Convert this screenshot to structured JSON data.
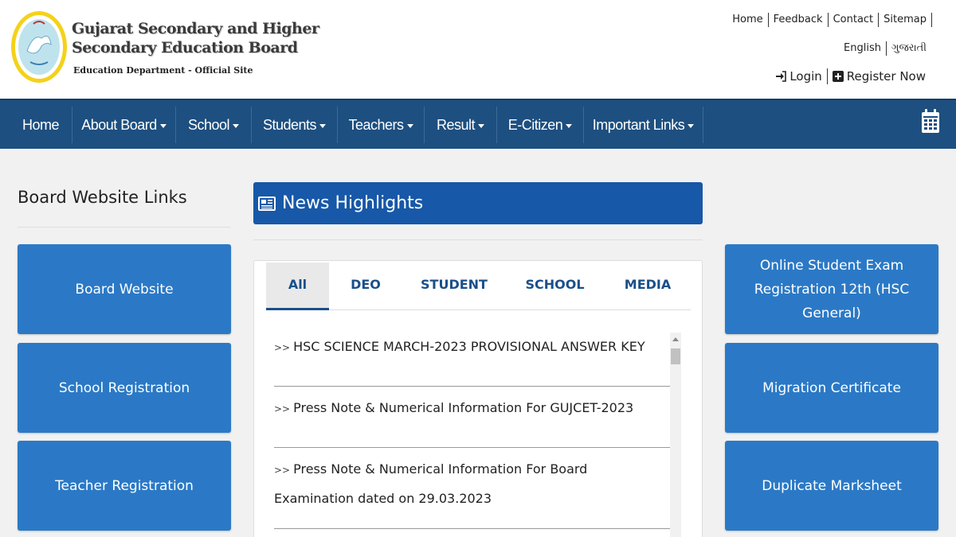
{
  "header": {
    "title_line1": "Gujarat Secondary and Higher",
    "title_line2": "Secondary Education Board",
    "subtitle": "Education Department - Official Site",
    "top_links": [
      "Home",
      "Feedback",
      "Contact",
      "Sitemap"
    ],
    "languages": [
      "English",
      "ગુજરાતી"
    ],
    "login_label": "Login",
    "register_label": "Register Now",
    "logo_icon": "board-emblem-logo"
  },
  "nav": {
    "items": [
      "Home",
      "About Board",
      "School",
      "Students",
      "Teachers",
      "Result",
      "E-Citizen",
      "Important Links"
    ],
    "calendar_icon": "calendar-icon",
    "bg_color": "#1d4f80"
  },
  "left": {
    "title": "Board Website Links",
    "tiles": [
      "Board Website",
      "School Registration",
      "Teacher Registration"
    ]
  },
  "news": {
    "title": "News Highlights",
    "tabs": [
      "All",
      "DEO",
      "STUDENT",
      "SCHOOL",
      "MEDIA"
    ],
    "active_tab": "All",
    "items": [
      "HSC SCIENCE MARCH-2023 PROVISIONAL ANSWER KEY",
      "Press Note & Numerical Information For GUJCET-2023",
      "Press Note & Numerical Information For Board Examination dated on 29.03.2023"
    ],
    "item_prefix": ">>"
  },
  "right": {
    "tiles": [
      "Online Student Exam Registration 12th (HSC General)",
      "Migration Certificate",
      "Duplicate Marksheet"
    ]
  },
  "colors": {
    "tile": "#2b79c6",
    "news_header": "#1758a8",
    "tab_text": "#1a4f8a"
  }
}
